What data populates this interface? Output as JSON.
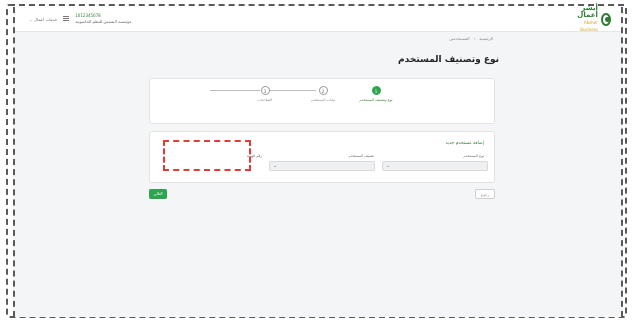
{
  "header": {
    "logo_ar": "أبشر أعمال",
    "logo_en": "Absher Business",
    "user_id": "1012345678",
    "user_name": "مؤسسة الشمس للنظم الحاسوبية",
    "services_label": "خدمات أعمال"
  },
  "breadcrumb": [
    "الرئيسية",
    "المستخدمين"
  ],
  "page": {
    "title": "نوع وتصنيف المستخدم"
  },
  "stepper": {
    "steps": [
      {
        "number": "1",
        "label": "نوع وتصنيف المستخدم",
        "active": true
      },
      {
        "number": "2",
        "label": "بيانات المستخدم",
        "active": false
      },
      {
        "number": "3",
        "label": "الصلاحيات",
        "active": false
      }
    ]
  },
  "form": {
    "title": "إضافة مستخدم جديد",
    "fields": [
      {
        "label": "نوع المستخدم",
        "value": ""
      },
      {
        "label": "تصنيف المستخدم",
        "value": ""
      },
      {
        "label": "رقم الهوية",
        "value": ""
      }
    ]
  },
  "buttons": {
    "next": "التالي",
    "back": "رجوع"
  }
}
